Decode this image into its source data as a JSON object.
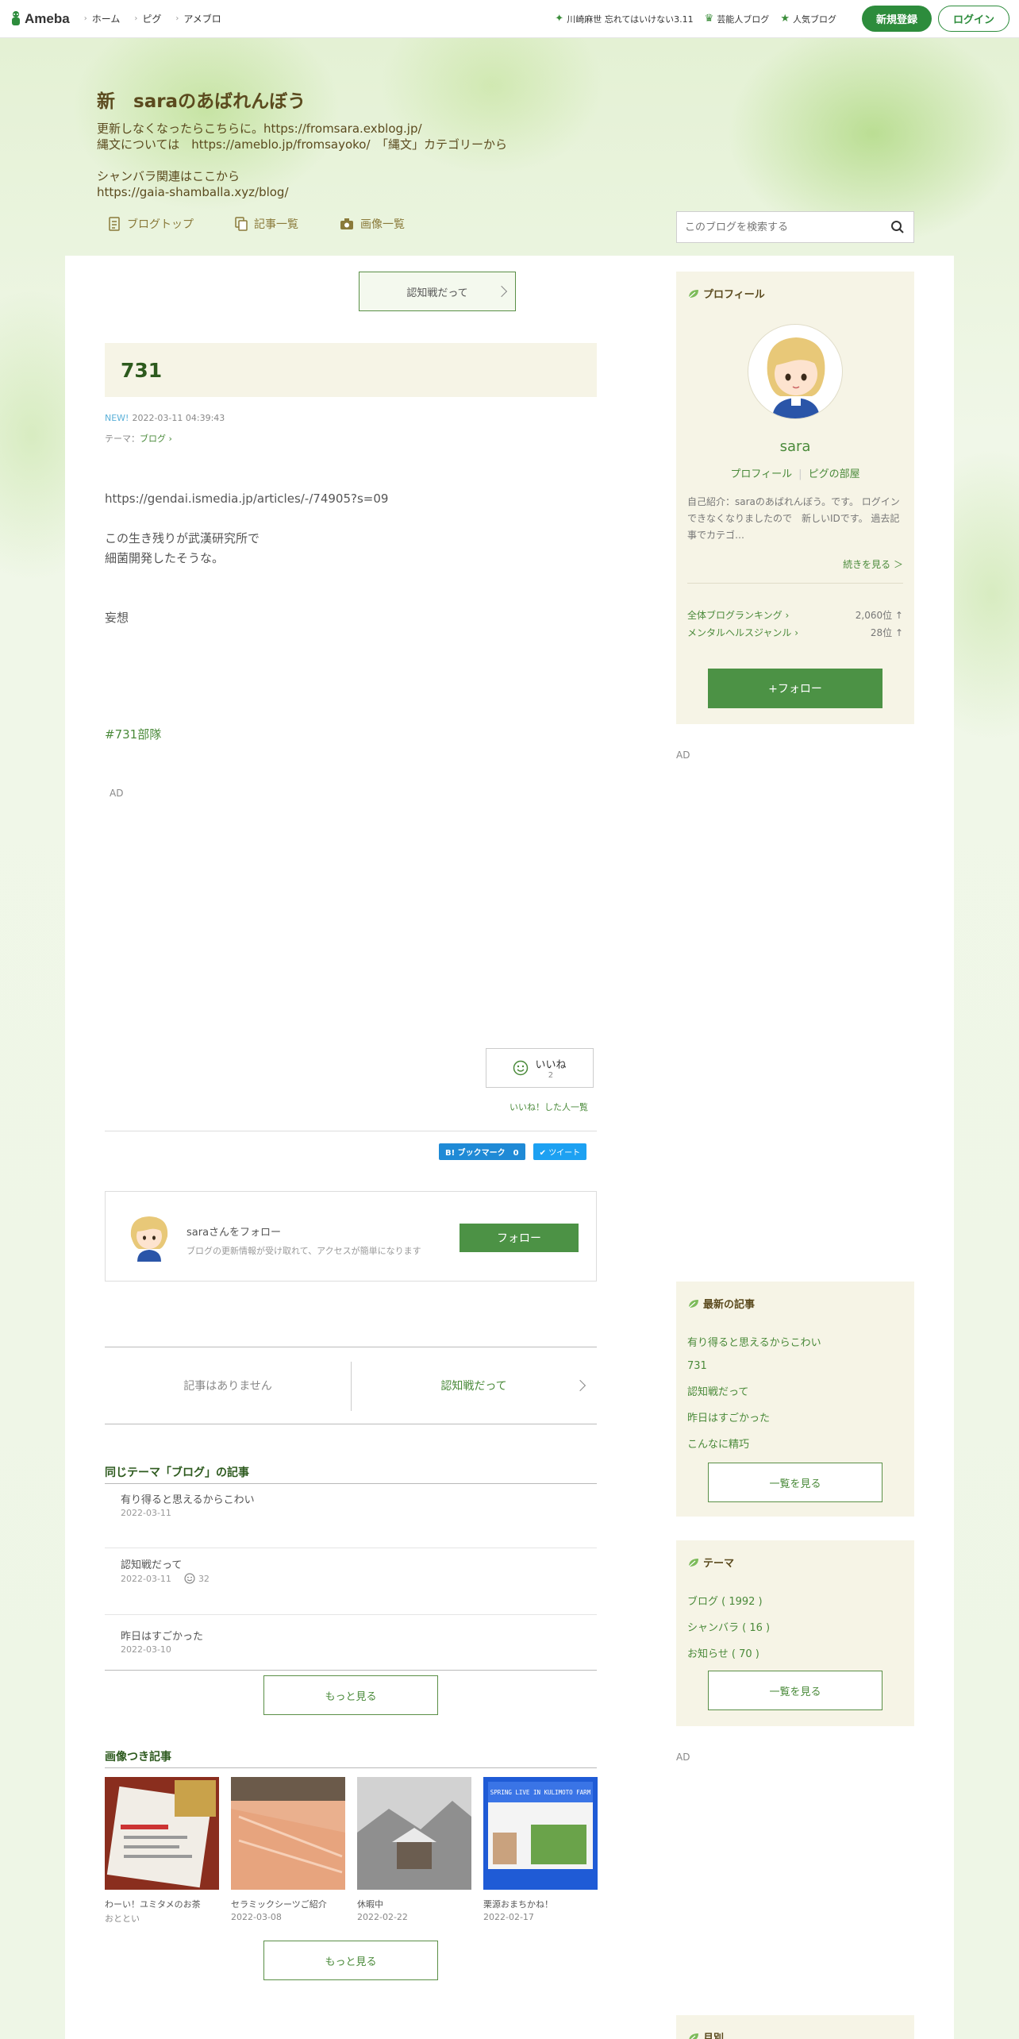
{
  "topbar": {
    "logo": "Ameba",
    "nav": [
      "ホーム",
      "ピグ",
      "アメブロ"
    ],
    "right_links": [
      "川崎麻世 忘れてはいけない3.11",
      "芸能人ブログ",
      "人気ブログ"
    ],
    "signup": "新規登録",
    "login": "ログイン"
  },
  "header": {
    "title": "新　saraのあばれんぼう",
    "desc": "更新しなくなったらこちらに。https://fromsara.exblog.jp/\n縄文については　https://ameblo.jp/fromsayoko/　「縄文」カテゴリーから\n\nシャンバラ関連はここから\nhttps://gaia-shamballa.xyz/blog/",
    "nav": [
      "ブログトップ",
      "記事一覧",
      "画像一覧"
    ],
    "search_placeholder": "このブログを検索する"
  },
  "entry": {
    "next_top": "認知戦だって",
    "title": "731",
    "new_badge": "NEW!",
    "datetime": "2022-03-11 04:39:43",
    "theme_label": "テーマ：",
    "theme": "ブログ",
    "url": "https://gendai.ismedia.jp/articles/-/74905?s=09",
    "para1_line1": "この生き残りが武漢研究所で",
    "para1_line2": "細菌開発したそうな。",
    "para2": "妄想",
    "hashtag": "#731部隊",
    "ad": "AD",
    "iine": "いいね",
    "iine_count": "2",
    "iine_list": "いいね！した人一覧",
    "bookmark": "B! ブックマーク　0",
    "tweet": "ツイート",
    "follow_name": "saraさんをフォロー",
    "follow_desc": "ブログの更新情報が受け取れて、アクセスが簡単になります",
    "follow_btn": "フォロー",
    "prev": "記事はありません",
    "next": "認知戦だって"
  },
  "same_theme": {
    "heading": "同じテーマ「ブログ」の記事",
    "items": [
      {
        "title": "有り得ると思えるからこわい",
        "date": "2022-03-11"
      },
      {
        "title": "認知戦だって",
        "date": "2022-03-11",
        "likes": "32"
      },
      {
        "title": "昨日はすごかった",
        "date": "2022-03-10"
      }
    ],
    "more": "もっと見る"
  },
  "images": {
    "heading": "画像つき記事",
    "items": [
      {
        "caption": "わーい！ユミタメのお茶",
        "date": "おととい"
      },
      {
        "caption": "セラミックシーツご紹介",
        "date": "2022-03-08"
      },
      {
        "caption": "休暇中",
        "date": "2022-02-22"
      },
      {
        "caption": "栗源おまちかね！",
        "date": "2022-02-17"
      }
    ],
    "poster_text": "SPRING LIVE IN KULIMOTO FARM",
    "more": "もっと見る"
  },
  "profile": {
    "heading": "プロフィール",
    "name": "sara",
    "link1": "プロフィール",
    "link2": "ピグの部屋",
    "intro": "自己紹介：saraのあばれんぼう。です。 ログインできなくなりましたので　新しいIDです。 過去記事でカテゴ…",
    "more": "続きを見る ＞",
    "rank1_label": "全体ブログランキング",
    "rank1_value": "2,060位 ↑",
    "rank2_label": "メンタルヘルスジャンル",
    "rank2_value": "28位 ↑",
    "follow": "+フォロー"
  },
  "sidebar": {
    "ad1": "AD",
    "ad2": "AD",
    "latest_heading": "最新の記事",
    "latest": [
      "有り得ると思えるからこわい",
      "731",
      "認知戦だって",
      "昨日はすごかった",
      "こんなに精巧"
    ],
    "latest_more": "一覧を見る",
    "theme_heading": "テーマ",
    "themes": [
      "ブログ ( 1992 )",
      "シャンバラ ( 16 )",
      "お知らせ ( 70 )"
    ],
    "theme_more": "一覧を見る",
    "monthly_heading": "月別"
  },
  "colors": {
    "accent": "#2d8c3c",
    "link": "#4a8a3a",
    "title": "#5b4a1e"
  }
}
